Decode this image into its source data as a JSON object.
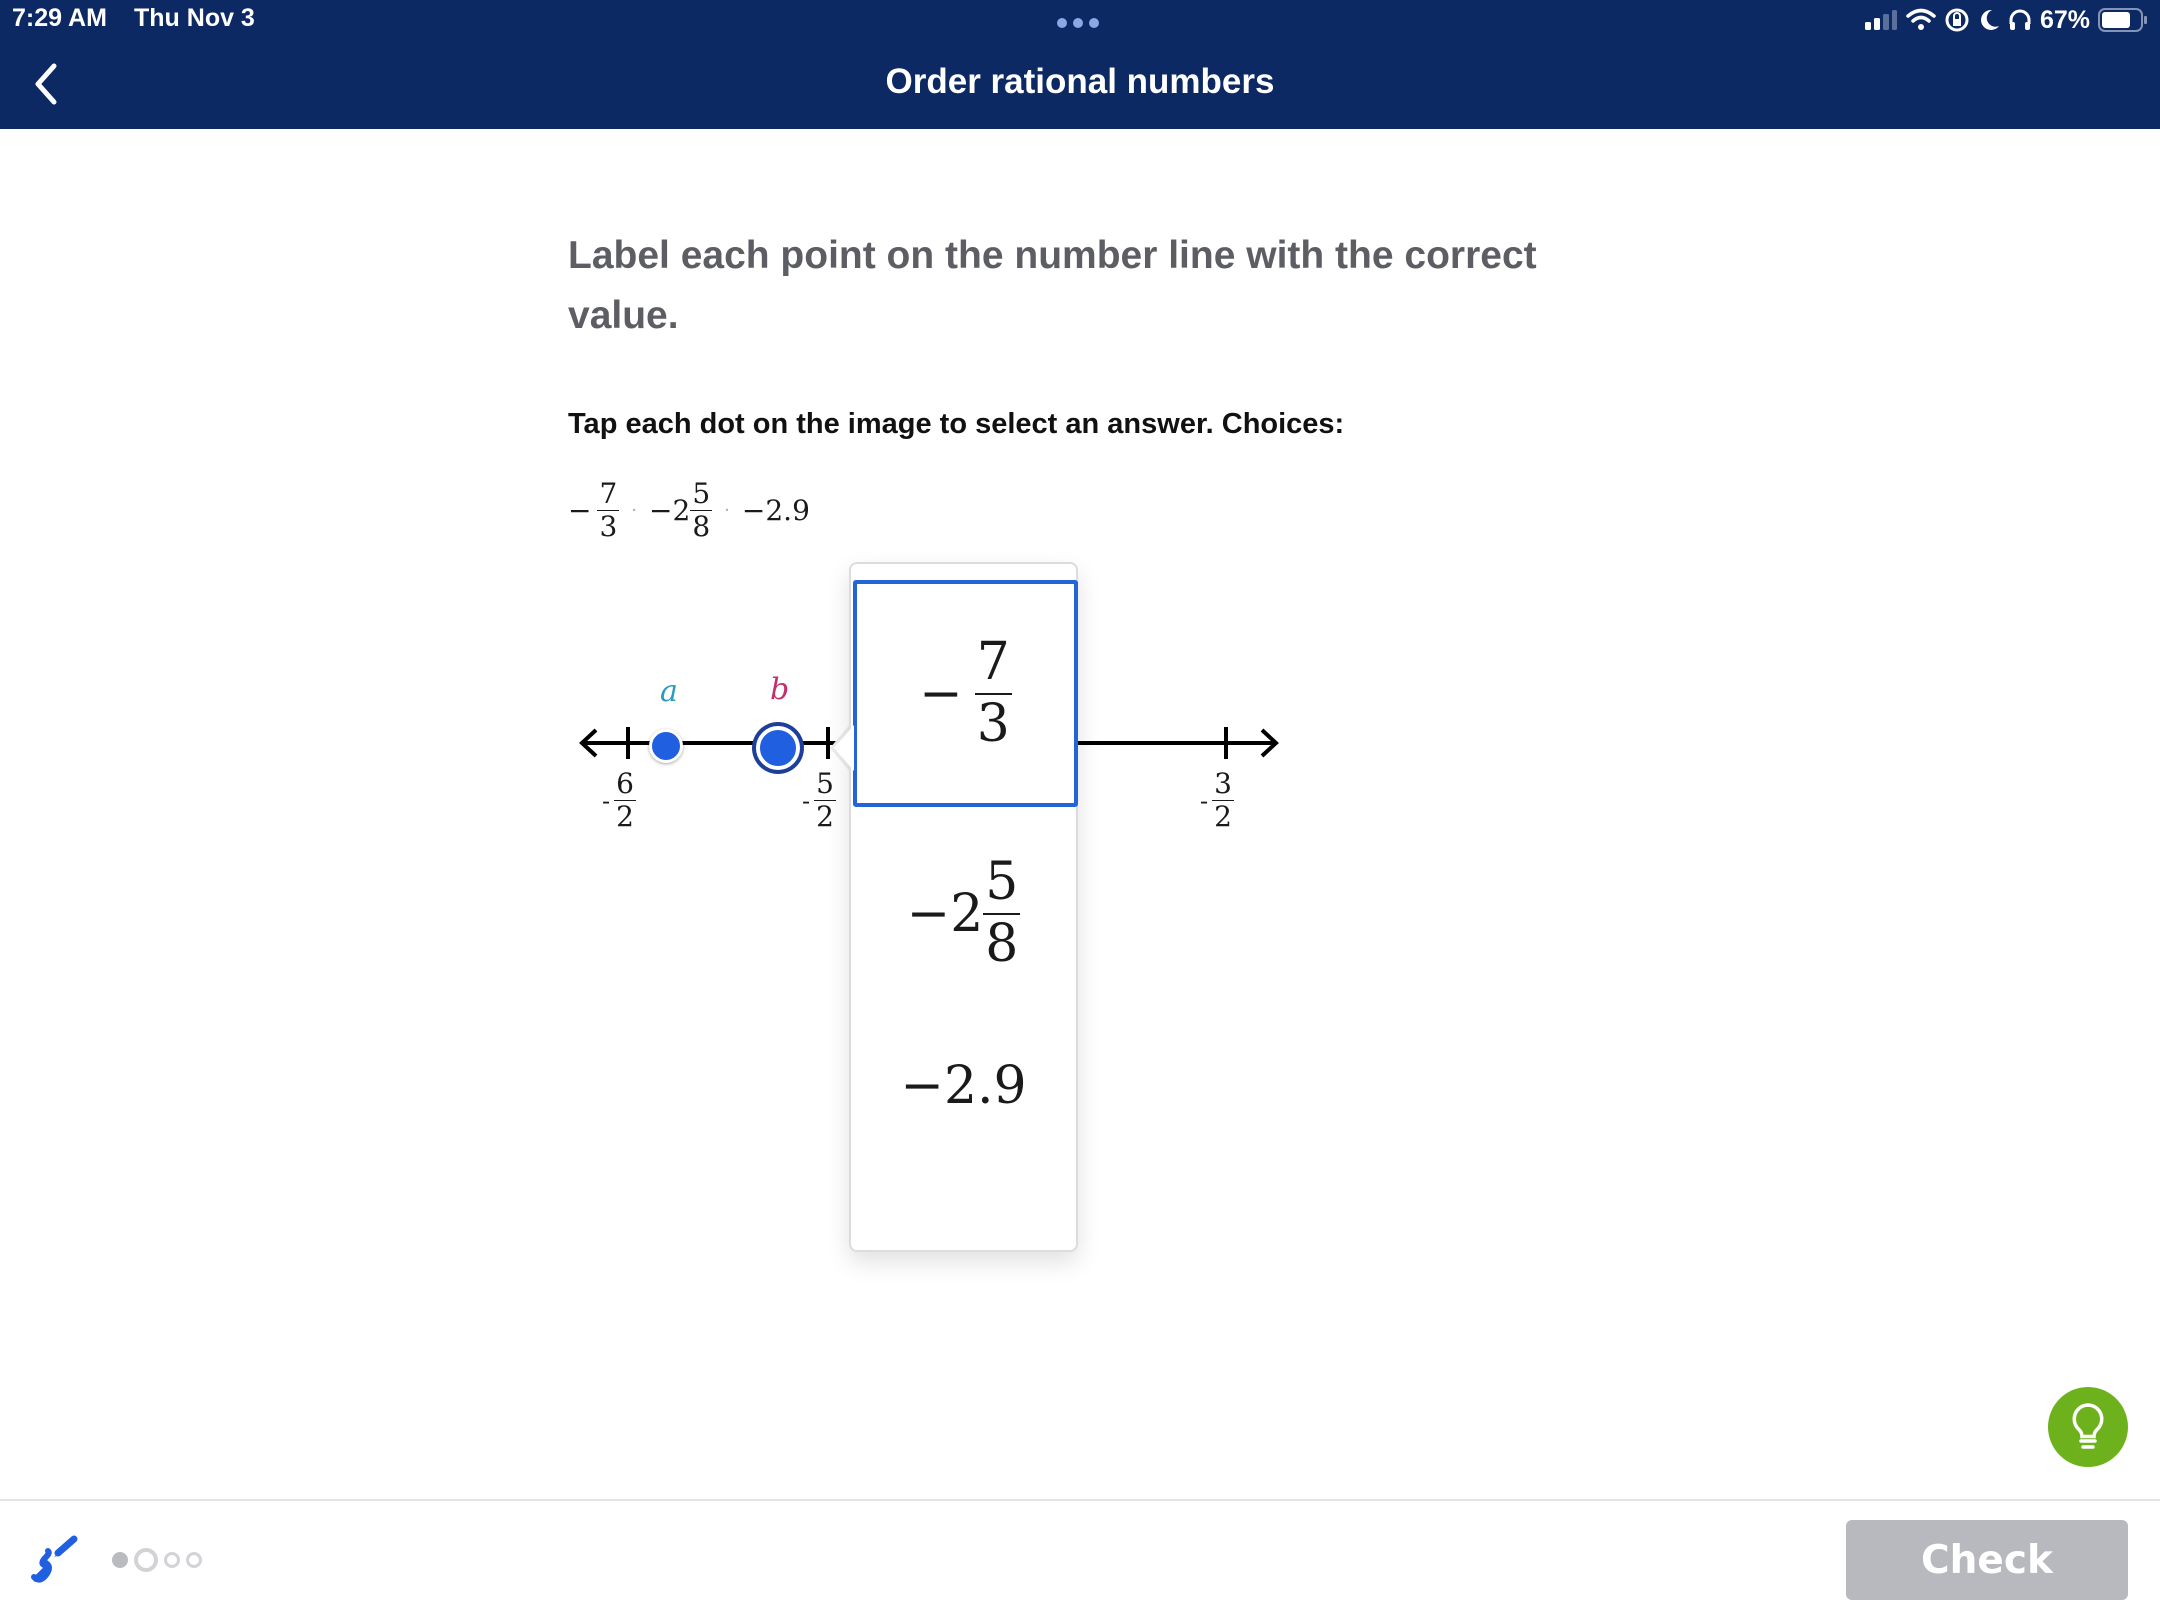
{
  "status_bar": {
    "time": "7:29 AM",
    "date": "Thu Nov 3",
    "battery": "67%",
    "icons": [
      "cellular-signal-icon",
      "wifi-icon",
      "rotation-lock-icon",
      "do-not-disturb-moon-icon",
      "headphones-icon",
      "battery-icon"
    ]
  },
  "header": {
    "title": "Order rational numbers",
    "back_icon": "chevron-left-icon"
  },
  "question": {
    "prompt": "Label each point on the number line with the correct value.",
    "instruction": "Tap each dot on the image to select an answer. Choices:",
    "choices": [
      {
        "sign": "−",
        "whole": "",
        "num": "7",
        "den": "3",
        "text": "−7/3"
      },
      {
        "sign": "−",
        "whole": "2",
        "num": "5",
        "den": "8",
        "text": "−2 5/8"
      },
      {
        "sign": "−",
        "whole": "",
        "decimal": "2.9",
        "text": "−2.9"
      }
    ]
  },
  "number_line": {
    "ticks": [
      {
        "sign": "-",
        "num": "6",
        "den": "2",
        "value": -3.0
      },
      {
        "sign": "-",
        "num": "5",
        "den": "2",
        "value": -2.5
      },
      {
        "sign": "-",
        "num": "3",
        "den": "2",
        "value": -1.5
      }
    ],
    "points": [
      {
        "label": "a",
        "color": "#2a9bbd",
        "selected": false
      },
      {
        "label": "b",
        "color": "#c2306b",
        "selected": true
      }
    ],
    "dot_color": "#1f5fe0"
  },
  "dropdown": {
    "options": [
      {
        "sign": "−",
        "whole": "",
        "num": "7",
        "den": "3",
        "selected": true
      },
      {
        "sign": "−",
        "whole": "2",
        "num": "5",
        "den": "8",
        "selected": false
      },
      {
        "sign": "−",
        "decimal": "2.9",
        "selected": false
      }
    ],
    "highlight_color": "#2364d8"
  },
  "footer": {
    "scratchpad_icon": "scratchpad-pencil-icon",
    "progress": [
      "done",
      "current",
      "todo",
      "todo"
    ],
    "check_label": "Check",
    "hint_icon": "lightbulb-icon"
  },
  "colors": {
    "header_bg": "#0c2964",
    "hint_green": "#6db21c",
    "check_disabled": "#b8b9be"
  }
}
